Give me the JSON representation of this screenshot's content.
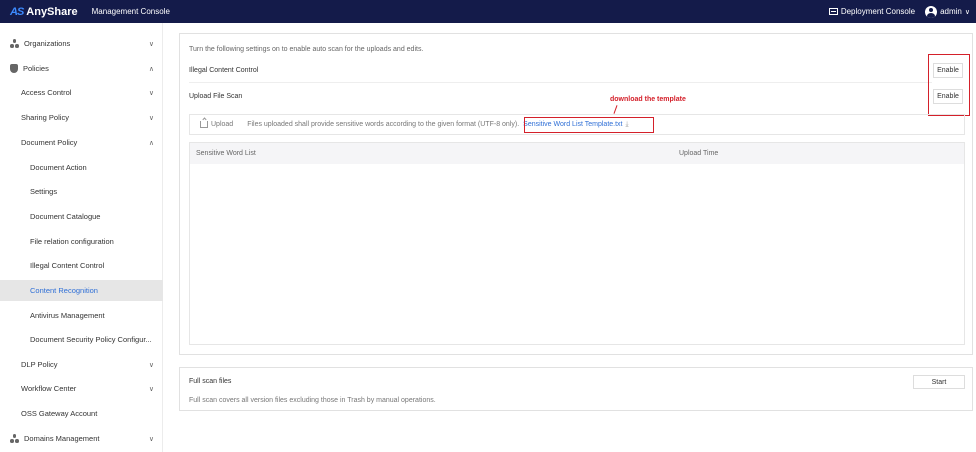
{
  "header": {
    "logo_mark": "AS",
    "app_name": "AnyShare",
    "console_title": "Management Console",
    "deployment_label": "Deployment Console",
    "user": "admin",
    "chevron": "∨"
  },
  "sidebar": {
    "items": [
      {
        "label": "Organizations",
        "chevron": "∨"
      },
      {
        "label": "Policies",
        "chevron": "∧"
      },
      {
        "label": "Access Control",
        "chevron": "∨"
      },
      {
        "label": "Sharing Policy",
        "chevron": "∨"
      },
      {
        "label": "Document Policy",
        "chevron": "∧"
      },
      {
        "label": "Document Action"
      },
      {
        "label": "Settings"
      },
      {
        "label": "Document Catalogue"
      },
      {
        "label": "File relation configuration"
      },
      {
        "label": "Illegal Content Control"
      },
      {
        "label": "Content Recognition"
      },
      {
        "label": "Antivirus Management"
      },
      {
        "label": "Document Security Policy Configur..."
      },
      {
        "label": "DLP Policy",
        "chevron": "∨"
      },
      {
        "label": "Workflow Center",
        "chevron": "∨"
      },
      {
        "label": "OSS Gateway Account"
      },
      {
        "label": "Domains Management",
        "chevron": "∨"
      }
    ]
  },
  "main": {
    "hint": "Turn the following settings on to enable auto scan for the uploads and edits.",
    "illegal_label": "Illegal Content Control",
    "illegal_button": "Enable",
    "upload_scan_label": "Upload File Scan",
    "upload_scan_button": "Enable",
    "upload_button": "Upload",
    "upload_desc": "Files uploaded shall provide sensitive words according to the given format (UTF-8 only).",
    "template_link": "Sensitive Word List Template.txt",
    "annotation": "download the template",
    "table_headers": [
      "Sensitive Word List",
      "Upload Time"
    ],
    "full_scan_title": "Full scan files",
    "full_scan_desc": "Full scan covers all version files excluding those in Trash by manual operations.",
    "start_button": "Start"
  },
  "colors": {
    "topbar": "#141b4a",
    "accent": "#2f6fd6",
    "annotation": "#d4202a"
  }
}
